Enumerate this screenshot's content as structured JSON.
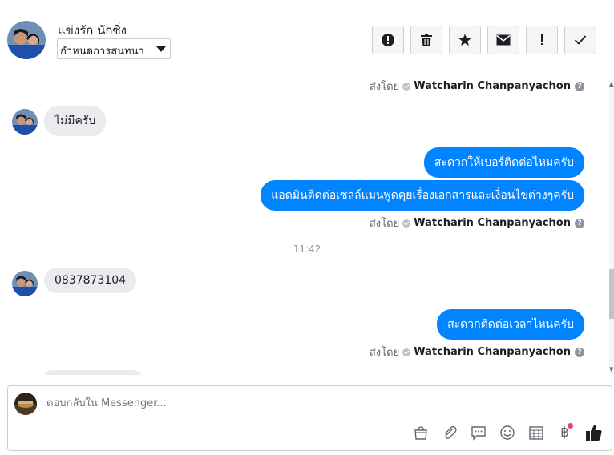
{
  "header": {
    "contact_name": "แข่งรัก นักซิ่ง",
    "assign_select": {
      "selected": "กำหนดการสนทนา"
    },
    "toolbar": [
      {
        "name": "spam-button",
        "icon": "alert-circle-icon"
      },
      {
        "name": "delete-button",
        "icon": "trash-icon"
      },
      {
        "name": "star-button",
        "icon": "star-icon"
      },
      {
        "name": "mark-unread-button",
        "icon": "envelope-icon"
      },
      {
        "name": "follow-up-button",
        "icon": "exclamation-icon"
      },
      {
        "name": "done-button",
        "icon": "check-icon"
      }
    ]
  },
  "thread": {
    "sent_by_label": "ส่งโดย",
    "agent_name": "Watcharin Chanpanyachon",
    "msg_in_1": "ไม่มีครับ",
    "msg_out_1": "สะดวกให้เบอร์ติดต่อไหมครับ",
    "msg_out_2": "แอดมินติดต่อเซลล์แมนพูดคุยเรื่องเอกสารและเงื่อนไขต่างๆครับ",
    "time_separator": "11:42",
    "msg_in_2": "0837873104",
    "msg_out_3": "สะดวกติดต่อเวลาไหนครับ"
  },
  "composer": {
    "placeholder": "ตอบกลับใน Messenger...",
    "tools": [
      "shopping-bag-icon",
      "paperclip-icon",
      "saved-reply-icon",
      "emoji-icon",
      "appointment-icon",
      "baht-payment-icon",
      "like-icon"
    ]
  },
  "colors": {
    "outgoing_bubble": "#0084ff",
    "incoming_bubble": "#e9ebee",
    "notification_dot": "#f3425f"
  }
}
